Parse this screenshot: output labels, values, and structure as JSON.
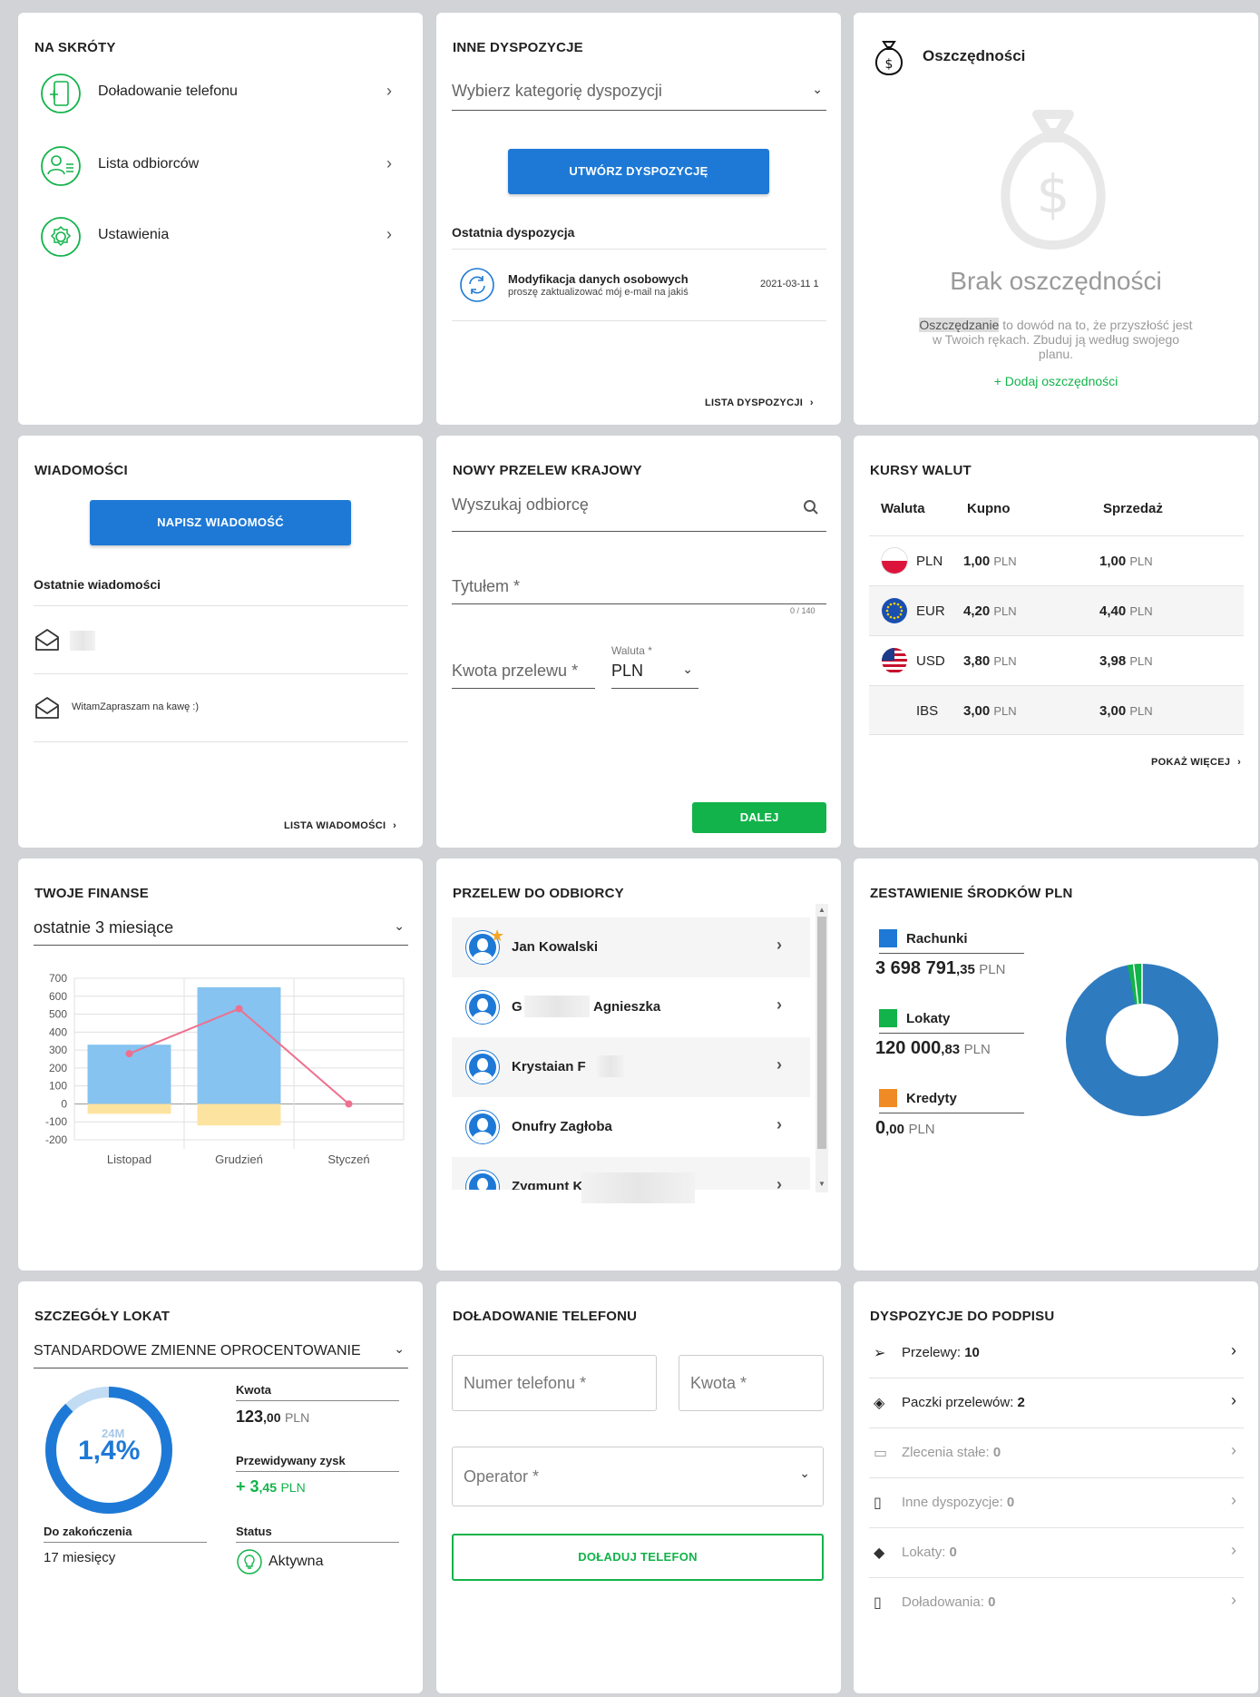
{
  "skroty": {
    "title": "NA SKRÓTY",
    "items": [
      {
        "label": "Doładowanie telefonu"
      },
      {
        "label": "Lista odbiorców"
      },
      {
        "label": "Ustawienia"
      }
    ]
  },
  "dyspozycje": {
    "title": "INNE DYSPOZYCJE",
    "select_placeholder": "Wybierz kategorię dyspozycji",
    "create_button": "UTWÓRZ DYSPOZYCJĘ",
    "last_label": "Ostatnia dyspozycja",
    "last_item": {
      "title": "Modyfikacja danych osobowych",
      "subtitle": "proszę zaktualizować mój e-mail na jakiś",
      "date": "2021-03-11 1"
    },
    "list_link": "LISTA DYSPOZYCJI"
  },
  "oszczednosci": {
    "title": "Oszczędności",
    "empty_title": "Brak oszczędności",
    "highlight": "Oszczędzanie",
    "description": " to dowód na to, że przyszłość jest w Twoich rękach. Zbuduj ją według swojego planu.",
    "add_link": "+ Dodaj oszczędności"
  },
  "wiadomosci": {
    "title": "WIADOMOŚCI",
    "write_button": "NAPISZ WIADOMOŚĆ",
    "recent_label": "Ostatnie wiadomości",
    "messages": [
      {
        "text": ""
      },
      {
        "text": "WitamZapraszam na kawę :)"
      }
    ],
    "list_link": "LISTA WIADOMOŚCI"
  },
  "przelew": {
    "title": "NOWY PRZELEW KRAJOWY",
    "search_placeholder": "Wyszukaj odbiorcę",
    "title_placeholder": "Tytułem *",
    "char_counter": "0 / 140",
    "amount_placeholder": "Kwota przelewu *",
    "currency_label": "Waluta *",
    "currency_value": "PLN",
    "next_button": "DALEJ"
  },
  "kursy": {
    "title": "KURSY WALUT",
    "headers": {
      "currency": "Waluta",
      "buy": "Kupno",
      "sell": "Sprzedaż"
    },
    "rows": [
      {
        "code": "PLN",
        "buy": "1,00",
        "sell": "1,00",
        "unit": "PLN",
        "flag": "pl-flag-icon"
      },
      {
        "code": "EUR",
        "buy": "4,20",
        "sell": "4,40",
        "unit": "PLN",
        "flag": "eu-flag-icon"
      },
      {
        "code": "USD",
        "buy": "3,80",
        "sell": "3,98",
        "unit": "PLN",
        "flag": "us-flag-icon"
      },
      {
        "code": "IBS",
        "buy": "3,00",
        "sell": "3,00",
        "unit": "PLN",
        "flag": ""
      }
    ],
    "more_link": "POKAŻ WIĘCEJ"
  },
  "finanse": {
    "title": "TWOJE FINANSE",
    "period": "ostatnie 3 miesiące"
  },
  "chart_data": {
    "type": "bar",
    "categories": [
      "Listopad",
      "Grudzień",
      "Styczeń"
    ],
    "series": [
      {
        "values": [
          330,
          650,
          0
        ],
        "color": "#86c3f0"
      },
      {
        "values": [
          -55,
          -120,
          0
        ],
        "color": "#fde3a0"
      },
      {
        "values": [
          280,
          530,
          0
        ],
        "color": "#ef6f8e",
        "kind": "line"
      }
    ],
    "yticks": [
      700,
      600,
      500,
      400,
      300,
      200,
      100,
      0,
      -100,
      -200
    ],
    "ylim": [
      -200,
      700
    ],
    "grid": true
  },
  "odbiorcy": {
    "title": "PRZELEW DO ODBIORCY",
    "recipients": [
      {
        "name": "Jan Kowalski",
        "favorite": true
      },
      {
        "name_a": "G",
        "name_b": "Agnieszka",
        "favorite": false
      },
      {
        "name": "Krystaian F",
        "favorite": false
      },
      {
        "name": "Onufry Zagłoba",
        "favorite": false
      },
      {
        "name": "Zygmunt K",
        "favorite": false
      }
    ]
  },
  "zestawienie": {
    "title": "ZESTAWIENIE ŚRODKÓW PLN",
    "items": [
      {
        "label": "Rachunki",
        "int": "3 698 791",
        "dec": ",35",
        "unit": "PLN",
        "color": "#1e79d6"
      },
      {
        "label": "Lokaty",
        "int": "120 000",
        "dec": ",83",
        "unit": "PLN",
        "color": "#12b34a"
      },
      {
        "label": "Kredyty",
        "int": "0",
        "dec": ",00",
        "unit": "PLN",
        "color": "#f08a24"
      }
    ],
    "donut_color_main": "#2f7bc0",
    "donut_color_secondary": "#12b34a"
  },
  "lokaty": {
    "title": "SZCZEGÓŁY LOKAT",
    "product": "STANDARDOWE ZMIENNE OPROCENTOWANIE",
    "rate": "1,4%",
    "term": "24M",
    "progress": 0.88,
    "amount_label": "Kwota",
    "amount_int": "123",
    "amount_dec": ",00",
    "amount_unit": "PLN",
    "profit_label": "Przewidywany zysk",
    "profit_int": "+ 3",
    "profit_dec": ",45",
    "profit_unit": "PLN",
    "end_label": "Do zakończenia",
    "end_value": "17 miesięcy",
    "status_label": "Status",
    "status_value": "Aktywna"
  },
  "doladowanie": {
    "title": "DOŁADOWANIE TELEFONU",
    "phone_placeholder": "Numer telefonu *",
    "amount_placeholder": "Kwota *",
    "operator_placeholder": "Operator *",
    "button": "DOŁADUJ TELEFON"
  },
  "podpis": {
    "title": "DYSPOZYCJE DO PODPISU",
    "items": [
      {
        "label": "Przelewy: ",
        "count": "10",
        "active": true
      },
      {
        "label": "Paczki przelewów: ",
        "count": "2",
        "active": true
      },
      {
        "label": "Zlecenia stałe: ",
        "count": "0",
        "active": false
      },
      {
        "label": "Inne dyspozycje: ",
        "count": "0",
        "active": false
      },
      {
        "label": "Lokaty: ",
        "count": "0",
        "active": false
      },
      {
        "label": "Doładowania: ",
        "count": "0",
        "active": false
      }
    ]
  }
}
